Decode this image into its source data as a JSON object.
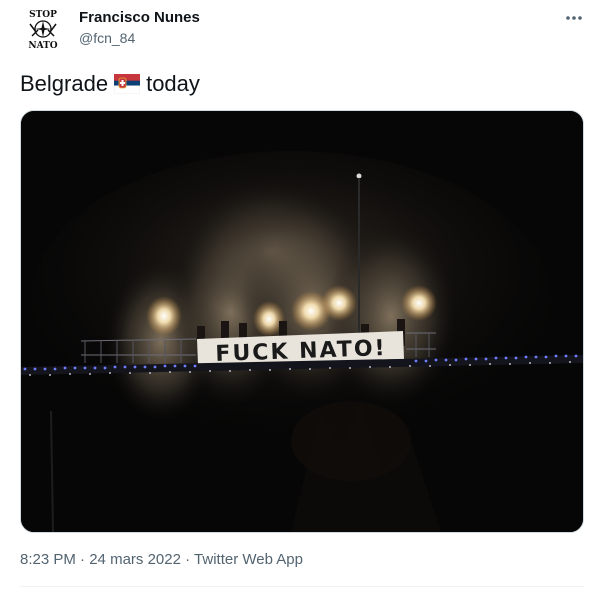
{
  "author": {
    "avatar_icon": "stop-nato-logo-icon",
    "avatar_text_top": "STOP",
    "avatar_text_bottom": "NATO",
    "display_name": "Francisco Nunes",
    "handle": "@fcn_84"
  },
  "more_icon": "more-options-icon",
  "tweet": {
    "text_before": "Belgrade",
    "flag_icon": "serbia-flag-icon",
    "text_after": "today"
  },
  "media": {
    "banner_text": "FUCK NATO!",
    "description_icon": "photo-bridge-flares"
  },
  "footer": {
    "time": "8:23 PM",
    "separator": "·",
    "date": "24 mars 2022",
    "source": "Twitter Web App"
  },
  "colors": {
    "text_primary": "#0f1419",
    "text_secondary": "#536471",
    "divider": "#eff3f4"
  }
}
